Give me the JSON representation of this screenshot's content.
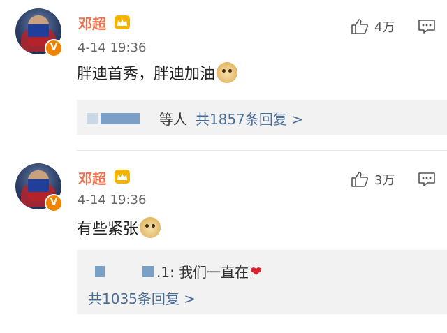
{
  "comments": [
    {
      "username": "邓超",
      "time": "4-14 19:36",
      "likes": "4万",
      "text": "胖迪首秀，胖迪加油",
      "reply_summary": {
        "suffix": "等人",
        "total_link": "共1857条回复 >"
      }
    },
    {
      "username": "邓超",
      "time": "4-14 19:36",
      "likes": "3万",
      "text": "有些紧张",
      "reply_preview": {
        "suffix": ".1: 我们一直在",
        "total_link": "共1035条回复 >"
      }
    }
  ],
  "icons": {
    "verified": "V",
    "crown": "crown-badge-icon",
    "like": "thumbs-up-icon",
    "comment": "comment-bubble-icon",
    "emoji": "doge-emoji-icon",
    "heart": "❤"
  },
  "colors": {
    "username": "#eb7350",
    "link": "#4a6d96",
    "verified": "#f08300",
    "reply_bg": "#f2f2f2"
  }
}
